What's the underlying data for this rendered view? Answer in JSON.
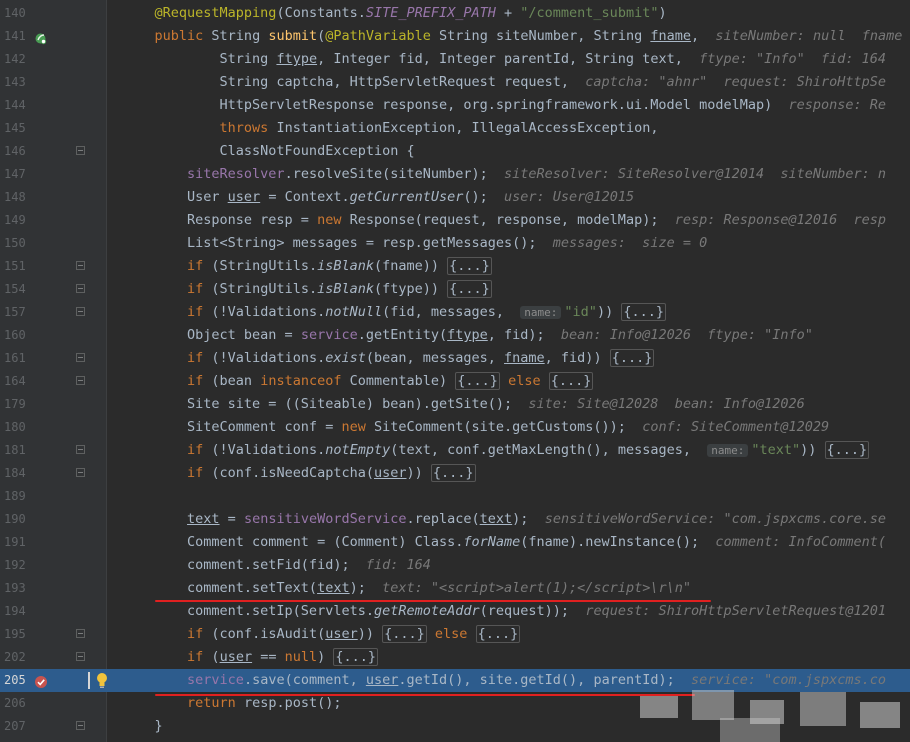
{
  "editor": {
    "lines": [
      {
        "n": "140",
        "html": "    <span class=\"ann\">@RequestMapping</span>(Constants.<span class=\"fld\">SITE_PREFIX_PATH</span> + <span class=\"str\">\"/comment_submit\"</span>)"
      },
      {
        "n": "141",
        "html": "    <span class=\"kw\">public</span> String <span class=\"fn\">submit</span>(<span class=\"ann\">@PathVariable</span> String siteNumber, String <span class=\"ul\">fname</span>,  <span class=\"hint\">siteNumber: null  fname</span>"
      },
      {
        "n": "142",
        "html": "            String <span class=\"ul\">ftype</span>, Integer fid, Integer parentId, String text,  <span class=\"hint\">ftype: \"Info\"  fid: 164</span>"
      },
      {
        "n": "143",
        "html": "            String captcha, HttpServletRequest request,  <span class=\"hint\">captcha: \"ahnr\"  request: ShiroHttpSe</span>"
      },
      {
        "n": "144",
        "html": "            HttpServletResponse response, org.springframework.ui.Model modelMap)  <span class=\"hint\">response: Re</span>"
      },
      {
        "n": "145",
        "html": "            <span class=\"kw\">throws</span> InstantiationException, IllegalAccessException,"
      },
      {
        "n": "146",
        "html": "            ClassNotFoundException {"
      },
      {
        "n": "147",
        "html": "        <span class=\"fld\" style=\"font-style:normal\">siteResolver</span>.resolveSite(siteNumber);  <span class=\"hint\">siteResolver: SiteResolver@12014  siteNumber: n</span>"
      },
      {
        "n": "148",
        "html": "        User <span class=\"ul\">user</span> = Context.<span class=\"st\">getCurrentUser</span>();  <span class=\"hint\">user: User@12015</span>"
      },
      {
        "n": "149",
        "html": "        Response resp = <span class=\"kw\">new</span> Response(request, response, modelMap);  <span class=\"hint\">resp: Response@12016  resp</span>"
      },
      {
        "n": "150",
        "html": "        List&lt;String&gt; messages = resp.getMessages();  <span class=\"hint\">messages:  size = 0</span>"
      },
      {
        "n": "151",
        "html": "        <span class=\"kw\">if</span> (StringUtils.<span class=\"st\">isBlank</span>(fname)) <span class=\"fc\">{...}</span>"
      },
      {
        "n": "154",
        "html": "        <span class=\"kw\">if</span> (StringUtils.<span class=\"st\">isBlank</span>(ftype)) <span class=\"fc\">{...}</span>"
      },
      {
        "n": "157",
        "html": "        <span class=\"kw\">if</span> (!Validations.<span class=\"st\">notNull</span>(fid, messages,  <span class=\"pn\">name:</span><span class=\"str\">\"id\"</span>)) <span class=\"fc\">{...}</span>"
      },
      {
        "n": "160",
        "html": "        Object bean = <span class=\"fld\" style=\"font-style:normal\">service</span>.getEntity(<span class=\"ul\">ftype</span>, fid);  <span class=\"hint\">bean: Info@12026  ftype: \"Info\"</span>"
      },
      {
        "n": "161",
        "html": "        <span class=\"kw\">if</span> (!Validations.<span class=\"st\">exist</span>(bean, messages, <span class=\"ul\">fname</span>, fid)) <span class=\"fc\">{...}</span>"
      },
      {
        "n": "164",
        "html": "        <span class=\"kw\">if</span> (bean <span class=\"kw\">instanceof</span> Commentable) <span class=\"fc\">{...}</span> <span class=\"kw\">else</span> <span class=\"fc\">{...}</span>"
      },
      {
        "n": "179",
        "html": "        Site site = ((Siteable) bean).getSite();  <span class=\"hint\">site: Site@12028  bean: Info@12026</span>"
      },
      {
        "n": "180",
        "html": "        SiteComment conf = <span class=\"kw\">new</span> SiteComment(site.getCustoms());  <span class=\"hint\">conf: SiteComment@12029</span>"
      },
      {
        "n": "181",
        "html": "        <span class=\"kw\">if</span> (!Validations.<span class=\"st\">notEmpty</span>(text, conf.getMaxLength(), messages,  <span class=\"pn\">name:</span><span class=\"str\">\"text\"</span>)) <span class=\"fc\">{...}</span>"
      },
      {
        "n": "184",
        "html": "        <span class=\"kw\">if</span> (conf.isNeedCaptcha(<span class=\"ul\">user</span>)) <span class=\"fc\">{...}</span>"
      },
      {
        "n": "189",
        "html": ""
      },
      {
        "n": "190",
        "html": "        <span class=\"ul\">text</span> = <span class=\"fld\" style=\"font-style:normal\">sensitiveWordService</span>.replace(<span class=\"ul\">text</span>);  <span class=\"hint\">sensitiveWordService: \"com.jspxcms.core.se</span>"
      },
      {
        "n": "191",
        "html": "        Comment comment = (Comment) Class.<span class=\"st\">forName</span>(fname).newInstance();  <span class=\"hint\">comment: InfoComment(</span>"
      },
      {
        "n": "192",
        "html": "        comment.setFid(fid);  <span class=\"hint\">fid: 164</span>"
      },
      {
        "n": "193",
        "html": "        comment.setText(<span class=\"ul\">text</span>);  <span class=\"hint\">text: \"&lt;script&gt;alert(1);&lt;/script&gt;\\r\\n\"</span>"
      },
      {
        "n": "194",
        "html": "        comment.setIp(Servlets.<span class=\"st\">getRemoteAddr</span>(request));  <span class=\"hint\">request: ShiroHttpServletRequest@1201</span>"
      },
      {
        "n": "195",
        "html": "        <span class=\"kw\">if</span> (conf.isAudit(<span class=\"ul\">user</span>)) <span class=\"fc\">{...}</span> <span class=\"kw\">else</span> <span class=\"fc\">{...}</span>"
      },
      {
        "n": "202",
        "html": "        <span class=\"kw\">if</span> (<span class=\"ul\">user</span> == <span class=\"kw\">null</span>) <span class=\"fc\">{...}</span>"
      },
      {
        "n": "205",
        "html": "        <span class=\"fld\" style=\"font-style:normal\">service</span>.save(comment, <span class=\"ul\">user</span>.getId(), site.getId(), parentId);  <span class=\"hint\">service: \"com.jspxcms.co</span>"
      },
      {
        "n": "206",
        "html": "        <span class=\"kw\">return</span> resp.post();"
      },
      {
        "n": "207",
        "html": "    }"
      }
    ]
  },
  "icons": {
    "breakpoint": "breakpoint-icon",
    "bulb": "lightbulb-icon",
    "spring": "spring-bean-icon"
  },
  "colors": {
    "background": "#2b2b2b",
    "current_line": "#2d5c8d",
    "underline": "#e02020"
  }
}
